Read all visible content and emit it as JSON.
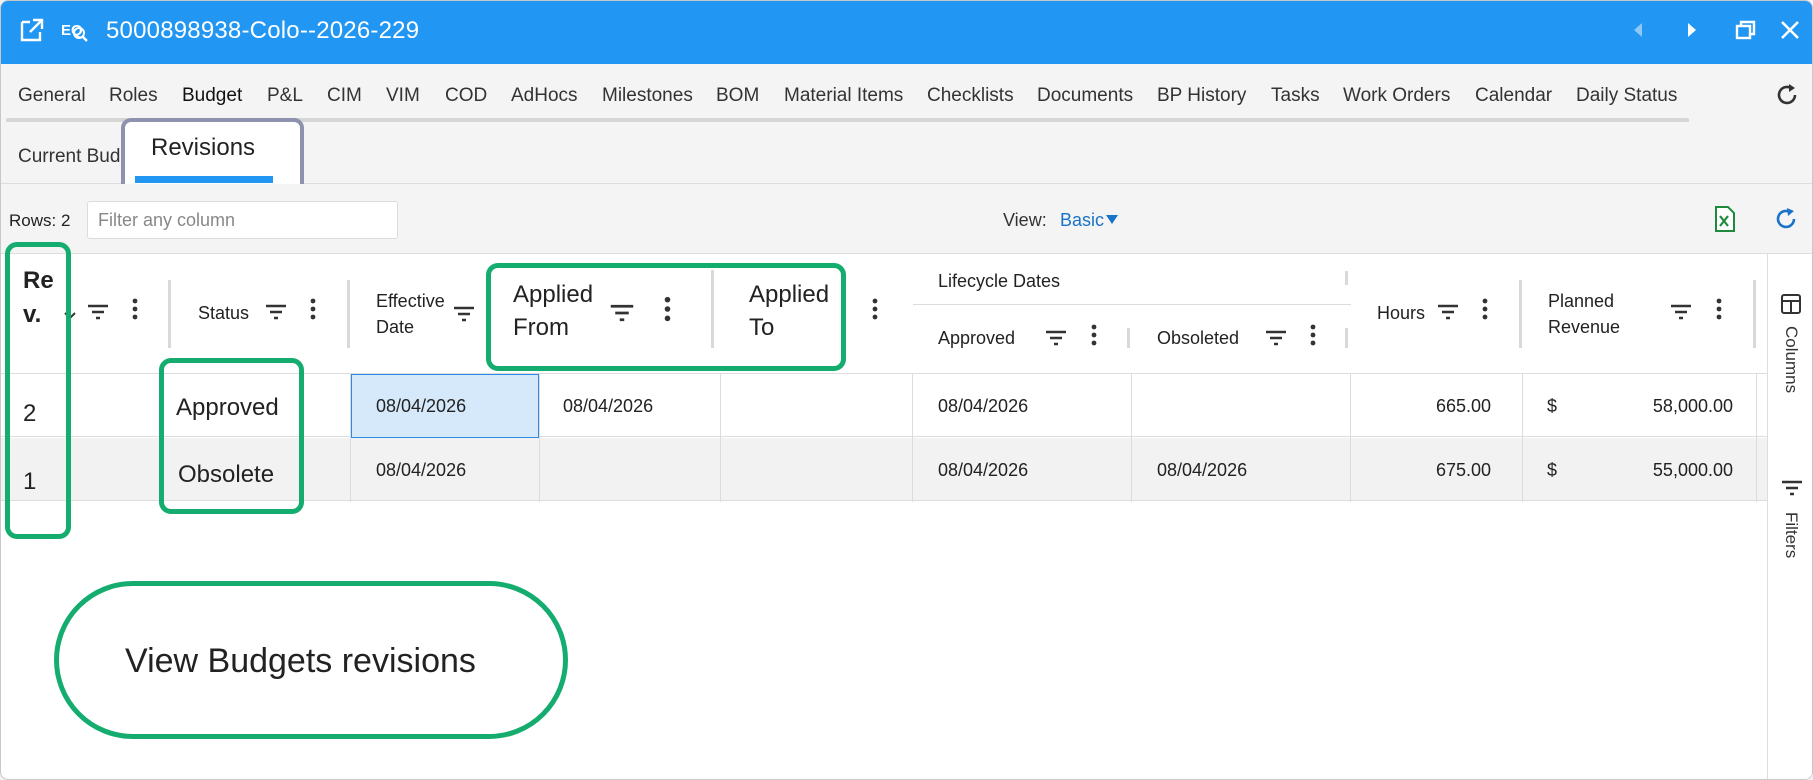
{
  "window": {
    "title": "5000898938-Colo--2026-229",
    "icons": [
      "external-link-icon",
      "eq-search-icon",
      "prev-icon",
      "next-icon",
      "restore-icon",
      "close-icon"
    ]
  },
  "tabs": [
    {
      "label": "General"
    },
    {
      "label": "Roles"
    },
    {
      "label": "Budget",
      "active": true
    },
    {
      "label": "P&L"
    },
    {
      "label": "CIM"
    },
    {
      "label": "VIM"
    },
    {
      "label": "COD"
    },
    {
      "label": "AdHocs"
    },
    {
      "label": "Milestones"
    },
    {
      "label": "BOM"
    },
    {
      "label": "Material Items"
    },
    {
      "label": "Checklists"
    },
    {
      "label": "Documents"
    },
    {
      "label": "BP History"
    },
    {
      "label": "Tasks"
    },
    {
      "label": "Work Orders"
    },
    {
      "label": "Calendar"
    },
    {
      "label": "Daily Status"
    }
  ],
  "subtabs": {
    "current": "Current Bud",
    "revisions": "Revisions"
  },
  "toolbar": {
    "rows_label": "Rows: 2",
    "filter_placeholder": "Filter any column",
    "view_label": "View:",
    "view_value": "Basic"
  },
  "grid": {
    "headers": {
      "rev": "Re v.",
      "status": "Status",
      "effective_date": "Effective Date",
      "applied_from": "Applied From",
      "applied_to": "Applied To",
      "lifecycle_dates": "Lifecycle Dates",
      "approved": "Approved",
      "obsoleted": "Obsoleted",
      "hours": "Hours",
      "planned_revenue": "Planned Revenue"
    },
    "rows": [
      {
        "rev": "2",
        "status": "Approved",
        "effective_date": "08/04/2026",
        "applied_from": "08/04/2026",
        "applied_to": "",
        "approved": "08/04/2026",
        "obsoleted": "",
        "hours": "665.00",
        "currency": "$",
        "planned_revenue": "58,000.00"
      },
      {
        "rev": "1",
        "status": "Obsolete",
        "effective_date": "08/04/2026",
        "applied_from": "",
        "applied_to": "",
        "approved": "08/04/2026",
        "obsoleted": "08/04/2026",
        "hours": "675.00",
        "currency": "$",
        "planned_revenue": "55,000.00"
      }
    ]
  },
  "side_panel": {
    "columns": "Columns",
    "filters": "Filters"
  },
  "annotation": {
    "callout": "View Budgets revisions"
  },
  "colors": {
    "titlebar": "#2196f3",
    "highlight": "#15ad6f",
    "selection": "#d6e9fb",
    "revisions_box": "#8e92ae"
  }
}
